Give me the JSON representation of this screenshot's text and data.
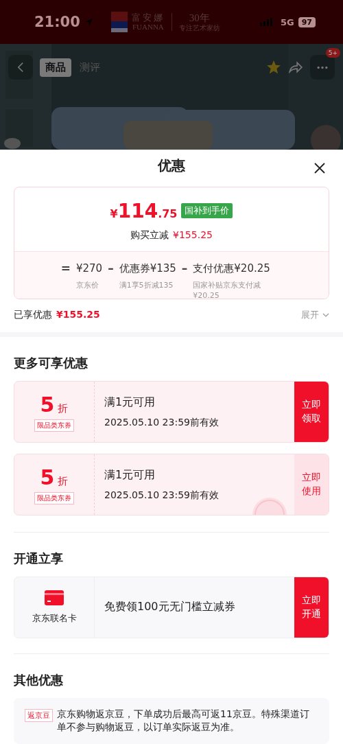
{
  "status_bar": {
    "time": "21:00",
    "ad_brand_cn": "富安娜",
    "ad_brand_en": "FUANNA",
    "ad_years": "30年",
    "ad_slogan": "专注艺术家纺",
    "network": "5G",
    "battery": "97"
  },
  "nav": {
    "tabs": [
      {
        "label": "商品",
        "selected": true
      },
      {
        "label": "测评",
        "selected": false
      }
    ],
    "badge": "5+"
  },
  "sheet": {
    "title": "优惠",
    "summary": {
      "currency": "¥",
      "price_int": "114",
      "price_dec": ".75",
      "price_tag": "国补到手价",
      "reduce_label": "购买立减",
      "reduce_value": "¥155.25",
      "formula": [
        {
          "op": "=",
          "value": "¥270",
          "note": "京东价"
        },
        {
          "op": "–",
          "value": "优惠券¥135",
          "note": "满1享5折减135"
        },
        {
          "op": "–",
          "value": "支付优惠¥20.25",
          "note": "国家补贴京东支付减¥20.25"
        }
      ]
    },
    "enjoyed": {
      "label": "已享优惠",
      "value": "¥155.25",
      "toggle": "展开"
    },
    "more": {
      "heading": "更多可享优惠",
      "coupons": [
        {
          "amount": "5",
          "unit": "折",
          "tag": "限品类东券",
          "title": "满1元可用",
          "validity": "2025.05.10 23:59前有效",
          "action": "立即领取",
          "claimed": false
        },
        {
          "amount": "5",
          "unit": "折",
          "tag": "限品类东券",
          "title": "满1元可用",
          "validity": "2025.05.10 23:59前有效",
          "action": "立即使用",
          "claimed": true
        }
      ]
    },
    "open": {
      "heading": "开通立享",
      "card_name": "京东联名卡",
      "offer": "免费领100元无门槛立减券",
      "action": "立即开通"
    },
    "other": {
      "heading": "其他优惠",
      "tag": "返京豆",
      "text": "京东购物返京豆，下单成功后最高可返11京豆。特殊渠道订单不参与购物返豆，以订单实际返豆为准。"
    }
  }
}
